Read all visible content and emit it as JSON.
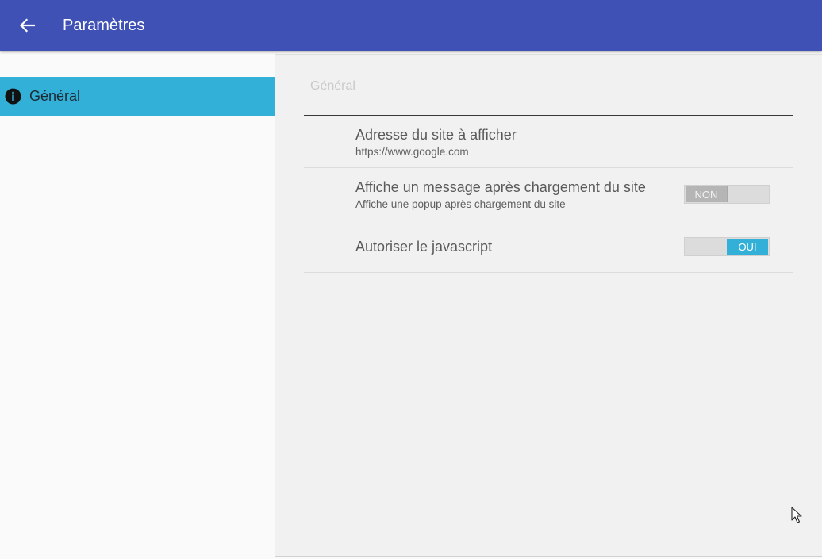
{
  "appbar": {
    "title": "Paramètres",
    "back_icon": "arrow-back-icon",
    "color": "#3f51b5"
  },
  "sidebar": {
    "items": [
      {
        "label": "Général",
        "icon": "info-icon",
        "selected": true,
        "color": "#33b0d8"
      }
    ]
  },
  "panel": {
    "section_title": "Général",
    "preferences": [
      {
        "title": "Adresse du site à afficher",
        "summary": "https://www.google.com"
      },
      {
        "title": "Affiche un message après chargement du site",
        "summary": "Affiche une popup après chargement du site",
        "switch_label": "NON",
        "checked": false
      },
      {
        "title": "Autoriser le javascript",
        "switch_label": "OUI",
        "checked": true
      }
    ]
  }
}
